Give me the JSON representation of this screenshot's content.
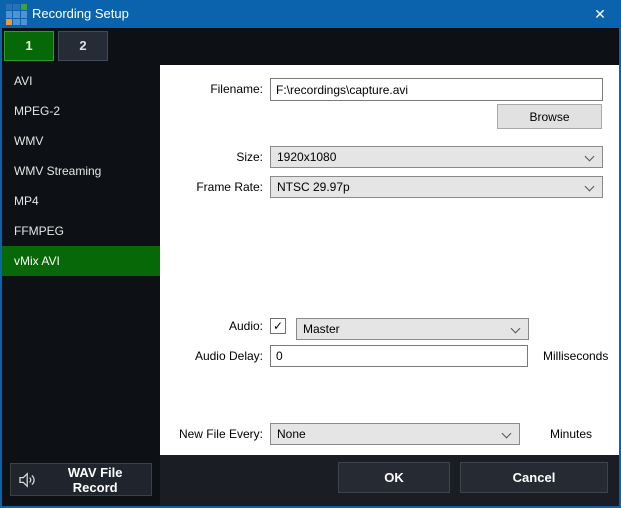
{
  "window": {
    "title": "Recording Setup",
    "close_glyph": "✕"
  },
  "logo": {
    "squares": [
      [
        "#2a72b8",
        "#2a72b8",
        "#3da33d"
      ],
      [
        "#4e93d4",
        "#4e93d4",
        "#4e93d4"
      ],
      [
        "#e89b2e",
        "#4e93d4",
        "#4e93d4"
      ]
    ]
  },
  "tabs": [
    {
      "label": "1"
    },
    {
      "label": "2"
    }
  ],
  "sidebar": {
    "selected_index": 6,
    "items": [
      {
        "label": "AVI"
      },
      {
        "label": "MPEG-2"
      },
      {
        "label": "WMV"
      },
      {
        "label": "WMV Streaming"
      },
      {
        "label": "MP4"
      },
      {
        "label": "FFMPEG"
      },
      {
        "label": "vMix AVI"
      }
    ]
  },
  "form": {
    "filename_label": "Filename:",
    "filename_value": "F:\\recordings\\capture.avi",
    "browse_label": "Browse",
    "size_label": "Size:",
    "size_value": "1920x1080",
    "framerate_label": "Frame Rate:",
    "framerate_value": "NTSC 29.97p",
    "audio_label": "Audio:",
    "audio_checked": true,
    "check_glyph": "✓",
    "audio_value": "Master",
    "audio_delay_label": "Audio Delay:",
    "audio_delay_value": "0",
    "audio_delay_unit": "Milliseconds",
    "new_file_label": "New File Every:",
    "new_file_value": "None",
    "new_file_unit": "Minutes"
  },
  "footer": {
    "wav_label": "WAV File Record",
    "ok_label": "OK",
    "cancel_label": "Cancel"
  },
  "colors": {
    "titlebar_blue": "#0a63ac",
    "dark_bg": "#0d1014",
    "bottom_bar": "#1a1e24",
    "selected_green": "#066806",
    "green_border": "#2f9b2f",
    "dark_button": "#262b33",
    "field_gray": "#e5e5e5",
    "panel_white": "#ffffff"
  }
}
